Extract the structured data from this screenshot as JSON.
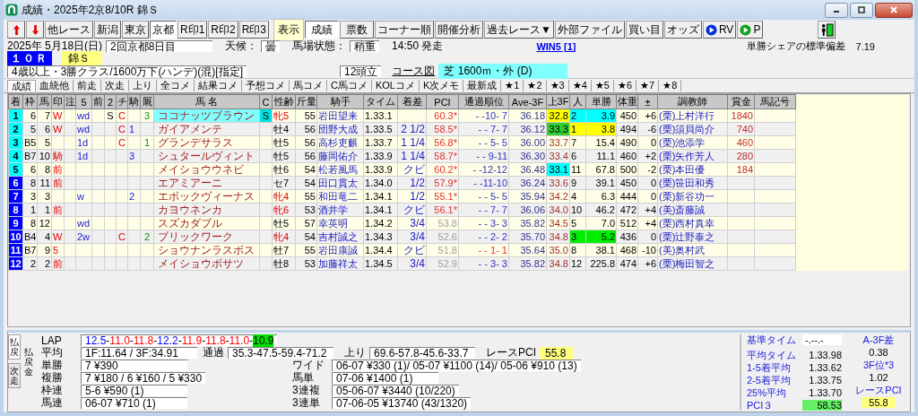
{
  "window": {
    "title": "成績・2025年2京8/10R 錦Ｓ"
  },
  "toolbar": {
    "race_button": "他レース",
    "venues": [
      {
        "label": "新潟",
        "selected": false
      },
      {
        "label": "東京",
        "selected": false
      },
      {
        "label": "京都",
        "selected": true
      }
    ],
    "marks": [
      "R印1",
      "R印2",
      "R印3"
    ],
    "display_label": "表示",
    "views": [
      {
        "label": "成績",
        "selected": true
      },
      {
        "label": "票数",
        "selected": false
      }
    ],
    "tools": [
      "コーナー順",
      "開催分析",
      "過去レース▼",
      "外部ファイル",
      "買い目",
      "オッズ"
    ],
    "players": [
      "RV",
      "P"
    ]
  },
  "race": {
    "date": "2025年 5月18日(日)",
    "meeting": "2回京都8日目",
    "weather_label": "天候：",
    "weather": "曇",
    "track_label": "馬場状態：",
    "track": "稍重",
    "start": "14:50 発走",
    "win5_link": "WIN5 [1]",
    "share_label": "単勝シェアの標準偏差",
    "share_value": "7.19",
    "number": "１０Ｒ",
    "name": "錦Ｓ",
    "condition": "4歳以上・3勝クラス/1600万下(ハンデ)(混)[指定]",
    "runners": "12頭立",
    "course_link": "コース図",
    "course": "芝 1600ｍ・外 (D)"
  },
  "tabs": [
    {
      "label": "成績",
      "selected": true
    },
    {
      "label": "血統他",
      "selected": false
    },
    {
      "label": "前走",
      "selected": false
    },
    {
      "label": "次走",
      "selected": false
    },
    {
      "label": "上り",
      "selected": false
    },
    {
      "label": "全コメ",
      "selected": false
    },
    {
      "label": "結果コメ",
      "selected": false
    },
    {
      "label": "予想コメ",
      "selected": false
    },
    {
      "label": "馬コメ",
      "selected": false
    },
    {
      "label": "C馬コメ",
      "selected": false
    },
    {
      "label": "KOLコメ",
      "selected": false
    },
    {
      "label": "K次メモ",
      "selected": false
    },
    {
      "label": "最新成",
      "selected": false
    },
    {
      "label": "★1",
      "selected": false
    },
    {
      "label": "★2",
      "selected": false
    },
    {
      "label": "★3",
      "selected": false
    },
    {
      "label": "★4",
      "selected": false
    },
    {
      "label": "★5",
      "selected": false
    },
    {
      "label": "★6",
      "selected": false
    },
    {
      "label": "★7",
      "selected": false
    },
    {
      "label": "★8",
      "selected": false
    }
  ],
  "table": {
    "columns": [
      "着",
      "枠",
      "馬",
      "印",
      "注",
      "5",
      "前",
      "2",
      "チ",
      "騎",
      "厩",
      "馬 名",
      "C",
      "性齢",
      "斤量",
      "騎手",
      "タイム",
      "着差",
      "PCI",
      "通過順位",
      "Ave-3F",
      "上3F",
      "人",
      "単勝",
      "体重",
      "±",
      "調教師",
      "賞金",
      "馬記号"
    ],
    "rows": [
      {
        "pos": {
          "text": "1",
          "color": "#00ffff"
        },
        "waku": "6",
        "num": "7",
        "mark": "W",
        "c5": "wd",
        "c2": "S",
        "chi": "C",
        "kyu": "3",
        "name": "ココナッツブラウン",
        "selected": true,
        "c": "S",
        "sex_age": "牝5",
        "female": true,
        "kin": "55",
        "jockey": "岩田望来",
        "time": "1.33.1",
        "pci": "60.3*",
        "pci_highlight": true,
        "passing": "- -10- 7",
        "passing_lead": false,
        "ave3f": "36.18",
        "last3f": {
          "text": "32.8",
          "color": "#ffff00"
        },
        "pop": {
          "text": "2",
          "color": "#00ffff"
        },
        "odds": {
          "text": "3.9",
          "color": "#00ffff"
        },
        "weight": "450",
        "diff": "+6",
        "trainer": "(栗)上村洋行",
        "prize": "1840"
      },
      {
        "pos": {
          "text": "2",
          "color": "#00ffff"
        },
        "waku": "5",
        "num": "6",
        "mark": "W",
        "c5": "wd",
        "chi": "C",
        "ki": "1",
        "name": "ガイアメンテ",
        "selected": false,
        "sex_age": "牡4",
        "female": false,
        "kin": "56",
        "jockey": "団野大成",
        "time": "1.33.5",
        "margin": "2 1/2",
        "pci": "58.5*",
        "pci_highlight": true,
        "passing": "- - 7- 7",
        "passing_lead": false,
        "ave3f": "36.12",
        "last3f": {
          "text": "33.3",
          "color": "#33cc33"
        },
        "pop": {
          "text": "1",
          "color": "#ffff00"
        },
        "odds": {
          "text": "3.8",
          "color": "#ffff00"
        },
        "weight": "494",
        "diff": "-6",
        "trainer": "(栗)須貝尚介",
        "prize": "740"
      },
      {
        "pos": {
          "text": "3",
          "color": "#00ffff"
        },
        "waku": "B5",
        "num": "5",
        "c5": "1d",
        "chi": "C",
        "kyu": "1",
        "name": "グランデサラス",
        "selected": false,
        "sex_age": "牡5",
        "female": false,
        "kin": "56",
        "jockey": "高杉吏麒",
        "time": "1.33.7",
        "margin": "1 1/4",
        "pci": "56.8*",
        "pci_highlight": true,
        "passing": "- - 5- 5",
        "passing_lead": false,
        "ave3f": "36.00",
        "last3f": "33.7",
        "pop": "7",
        "odds": "15.4",
        "weight": "490",
        "diff": "0",
        "trainer": "(栗)池添学",
        "prize": "460"
      },
      {
        "pos": {
          "text": "4",
          "color": "#00ffff"
        },
        "waku": "B7",
        "num": "10",
        "mark": "騎",
        "c5": "1d",
        "ki": "3",
        "name": "シュタールヴィント",
        "selected": false,
        "sex_age": "牡5",
        "female": false,
        "kin": "56",
        "jockey": "藤岡佑介",
        "time": "1.33.9",
        "margin": "1 1/4",
        "pci": "58.7*",
        "pci_highlight": true,
        "passing": "- - 9-11",
        "passing_lead": false,
        "ave3f": "36.30",
        "last3f": "33.4",
        "pop": "6",
        "odds": "11.1",
        "weight": "460",
        "diff": "+2",
        "trainer": "(栗)矢作芳人",
        "prize": "280"
      },
      {
        "pos": {
          "text": "5",
          "color": "#00ffff"
        },
        "waku": "6",
        "num": "8",
        "mark": "前",
        "name": "メイショウウネビ",
        "selected": false,
        "sex_age": "牡6",
        "female": false,
        "kin": "54",
        "jockey": "松若風馬",
        "time": "1.33.9",
        "margin": "クビ",
        "pci": "60.2*",
        "pci_highlight": true,
        "passing": "- -12-12",
        "passing_lead": false,
        "ave3f": "36.48",
        "last3f": {
          "text": "33.1",
          "color": "#00ffff"
        },
        "pop": "11",
        "odds": "67.8",
        "weight": "500",
        "diff": "-2",
        "trainer": "(栗)本田優",
        "prize": "184"
      },
      {
        "pos": {
          "text": "6",
          "color": "#0000ff"
        },
        "waku": "8",
        "num": "11",
        "mark": "前",
        "name": "エアミアーニ",
        "selected": false,
        "sex_age": "セ7",
        "female": false,
        "kin": "54",
        "jockey": "田口貫太",
        "time": "1.34.0",
        "margin": "1/2",
        "pci": "57.9*",
        "pci_highlight": true,
        "passing": "- -11-10",
        "passing_lead": false,
        "ave3f": "36.24",
        "last3f": "33.6",
        "pop": "9",
        "odds": "39.1",
        "weight": "450",
        "diff": "0",
        "trainer": "(栗)笹田和秀"
      },
      {
        "pos": {
          "text": "7",
          "color": "#0000ff"
        },
        "waku": "3",
        "num": "3",
        "c5": "w",
        "ki": "2",
        "name": "エボックヴィーナス",
        "selected": false,
        "sex_age": "牝4",
        "female": true,
        "kin": "55",
        "jockey": "和田竜二",
        "time": "1.34.1",
        "margin": "1/2",
        "pci": "55.1*",
        "pci_highlight": true,
        "passing": "- - 5- 5",
        "passing_lead": false,
        "ave3f": "35.94",
        "last3f": "34.2",
        "pop": "4",
        "odds": "6.3",
        "weight": "444",
        "diff": "0",
        "trainer": "(栗)新谷功一"
      },
      {
        "pos": {
          "text": "8",
          "color": "#0000ff"
        },
        "waku": "1",
        "num": "1",
        "mark": "前",
        "name": "カヨウネンカ",
        "selected": false,
        "sex_age": "牝6",
        "female": true,
        "kin": "53",
        "jockey": "酒井学",
        "time": "1.34.1",
        "margin": "クビ",
        "pci": "56.1*",
        "pci_highlight": true,
        "passing": "- - 7- 7",
        "passing_lead": false,
        "ave3f": "36.06",
        "last3f": "34.0",
        "pop": "10",
        "odds": "46.2",
        "weight": "472",
        "diff": "+4",
        "trainer": "(美)斎藤誠"
      },
      {
        "pos": {
          "text": "9",
          "color": "#0000ff"
        },
        "waku": "8",
        "num": "12",
        "c5": "wd",
        "name": "スズカダブル",
        "selected": false,
        "sex_age": "牡5",
        "female": false,
        "kin": "57",
        "jockey": "幸英明",
        "time": "1.34.2",
        "margin": "3/4",
        "pci": "53.8",
        "pci_highlight": false,
        "passing": "- - 3- 3",
        "passing_lead": false,
        "ave3f": "35.82",
        "last3f": "34.5",
        "pop": "5",
        "odds": "7.0",
        "weight": "512",
        "diff": "+4",
        "trainer": "(栗)西村真幸"
      },
      {
        "pos": {
          "text": "10",
          "color": "#0000ff"
        },
        "waku": "B4",
        "num": "4",
        "mark": "W",
        "c5": "2w",
        "chi": "C",
        "kyu": "2",
        "name": "ブリックワーク",
        "selected": false,
        "sex_age": "牝4",
        "female": true,
        "kin": "54",
        "jockey": "吉村誠之",
        "time": "1.34.3",
        "margin": "3/4",
        "pci": "52.6",
        "pci_highlight": false,
        "passing": "- - 2- 2",
        "passing_lead": false,
        "ave3f": "35.70",
        "last3f": "34.8",
        "pop": {
          "text": "3",
          "color": "#00ee00"
        },
        "odds": {
          "text": "5.2",
          "color": "#00ee00"
        },
        "weight": "436",
        "diff": "0",
        "trainer": "(栗)辻野泰之"
      },
      {
        "pos": {
          "text": "11",
          "color": "#0000ff"
        },
        "waku": "B7",
        "num": "9",
        "mark": "5",
        "name": "ショウナンラスボス",
        "selected": false,
        "sex_age": "牡7",
        "female": false,
        "kin": "55",
        "jockey": "岩田康誠",
        "time": "1.34.4",
        "margin": "クビ",
        "pci": "51.8",
        "pci_highlight": false,
        "passing": "- - 1- 1",
        "passing_lead": true,
        "ave3f": "35.64",
        "last3f": "35.0",
        "pop": "8",
        "odds": "38.1",
        "weight": "468",
        "diff": "-10",
        "trainer": "(美)奥村武"
      },
      {
        "pos": {
          "text": "12",
          "color": "#0000ff"
        },
        "waku": "2",
        "num": "2",
        "mark": "前",
        "name": "メイショウボサツ",
        "selected": false,
        "sex_age": "牡8",
        "female": false,
        "kin": "53",
        "jockey": "加藤祥太",
        "time": "1.34.5",
        "margin": "3/4",
        "pci": "52.9",
        "pci_highlight": false,
        "passing": "- - 3- 3",
        "passing_lead": false,
        "ave3f": "35.82",
        "last3f": "34.8",
        "pop": "12",
        "odds": "225.8",
        "weight": "474",
        "diff": "+6",
        "trainer": "(栗)梅田智之"
      }
    ]
  },
  "result": {
    "side_tabs": [
      {
        "label": "払戻",
        "selected": true
      },
      {
        "label": "次走",
        "selected": false
      }
    ],
    "panel_label": "払戻金",
    "lap_label": "LAP",
    "laps": [
      {
        "text": "12.5",
        "color": "#0000ff"
      },
      {
        "text": "-"
      },
      {
        "text": "11.0",
        "color": "#ff0000"
      },
      {
        "text": "-"
      },
      {
        "text": "11.8",
        "color": "#ff0000"
      },
      {
        "text": "-"
      },
      {
        "text": "12.2",
        "color": "#0000ff"
      },
      {
        "text": "-"
      },
      {
        "text": "11.9",
        "color": "#ff0000"
      },
      {
        "text": "-"
      },
      {
        "text": "11.8",
        "color": "#ff0000"
      },
      {
        "text": "-"
      },
      {
        "text": "11.0",
        "color": "#ff0000"
      },
      {
        "text": "-"
      },
      {
        "text": "10.9",
        "highlight": true
      }
    ],
    "avg_label": "平均",
    "avg": "1F:11.64 / 3F:34.91",
    "pass_label": "通過",
    "pass": "35.3-47.5-59.4-71.2",
    "last_label": "上り",
    "last": "69.6-57.8-45.6-33.7",
    "pci_label": "レースPCI",
    "pci": "55.8",
    "payouts_left": [
      {
        "label": "単勝",
        "value": "7 ¥390"
      },
      {
        "label": "複勝",
        "value": "7 ¥180 / 6 ¥160 / 5 ¥330"
      },
      {
        "label": "枠連",
        "value": "5-6 ¥590 (1)"
      },
      {
        "label": "馬連",
        "value": "06-07 ¥710 (1)"
      }
    ],
    "payouts_right": [
      {
        "label": "ワイド",
        "value": "06-07 ¥330 (1)/ 05-07 ¥1100 (14)/ 05-06 ¥910 (13)"
      },
      {
        "label": "馬単",
        "value": "07-06 ¥1400 (1)"
      },
      {
        "label": "3連複",
        "value": "05-06-07 ¥3440 (10/220)"
      },
      {
        "label": "3連単",
        "value": "07-06-05 ¥13740 (43/1320)"
      }
    ]
  },
  "stats": {
    "rows": [
      {
        "label": "基準タイム",
        "value": "-.--.-",
        "kind": "field"
      },
      {
        "label": "平均タイム",
        "value": "1.33.98",
        "kind": "plain"
      },
      {
        "label": "1-5着平均",
        "value": "1.33.62",
        "kind": "plain"
      },
      {
        "label": "2-5着平均",
        "value": "1.33.75",
        "kind": "plain"
      },
      {
        "label": "25%平均",
        "value": "1.33.70",
        "kind": "plain"
      },
      {
        "label": "PCI３",
        "value": "58.53",
        "kind": "good"
      }
    ],
    "side": [
      {
        "label": "A-3F差",
        "value": "0.38",
        "kind": "plain"
      },
      {
        "label": "3F位*3",
        "value": "1.02",
        "kind": "plain"
      },
      {
        "label": "レースPCI",
        "value": "55.8",
        "kind": "pci"
      }
    ]
  }
}
